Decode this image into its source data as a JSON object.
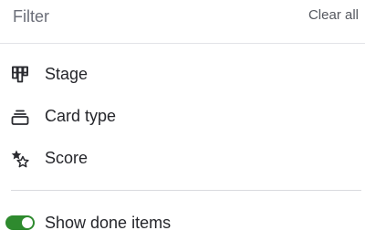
{
  "header": {
    "title": "Filter",
    "clear_label": "Clear all"
  },
  "filters": [
    {
      "label": "Stage",
      "icon": "stage-icon"
    },
    {
      "label": "Card type",
      "icon": "card-type-icon"
    },
    {
      "label": "Score",
      "icon": "score-icon"
    }
  ],
  "show_done": {
    "label": "Show done items",
    "enabled": true,
    "color": "#2e8a2e"
  }
}
